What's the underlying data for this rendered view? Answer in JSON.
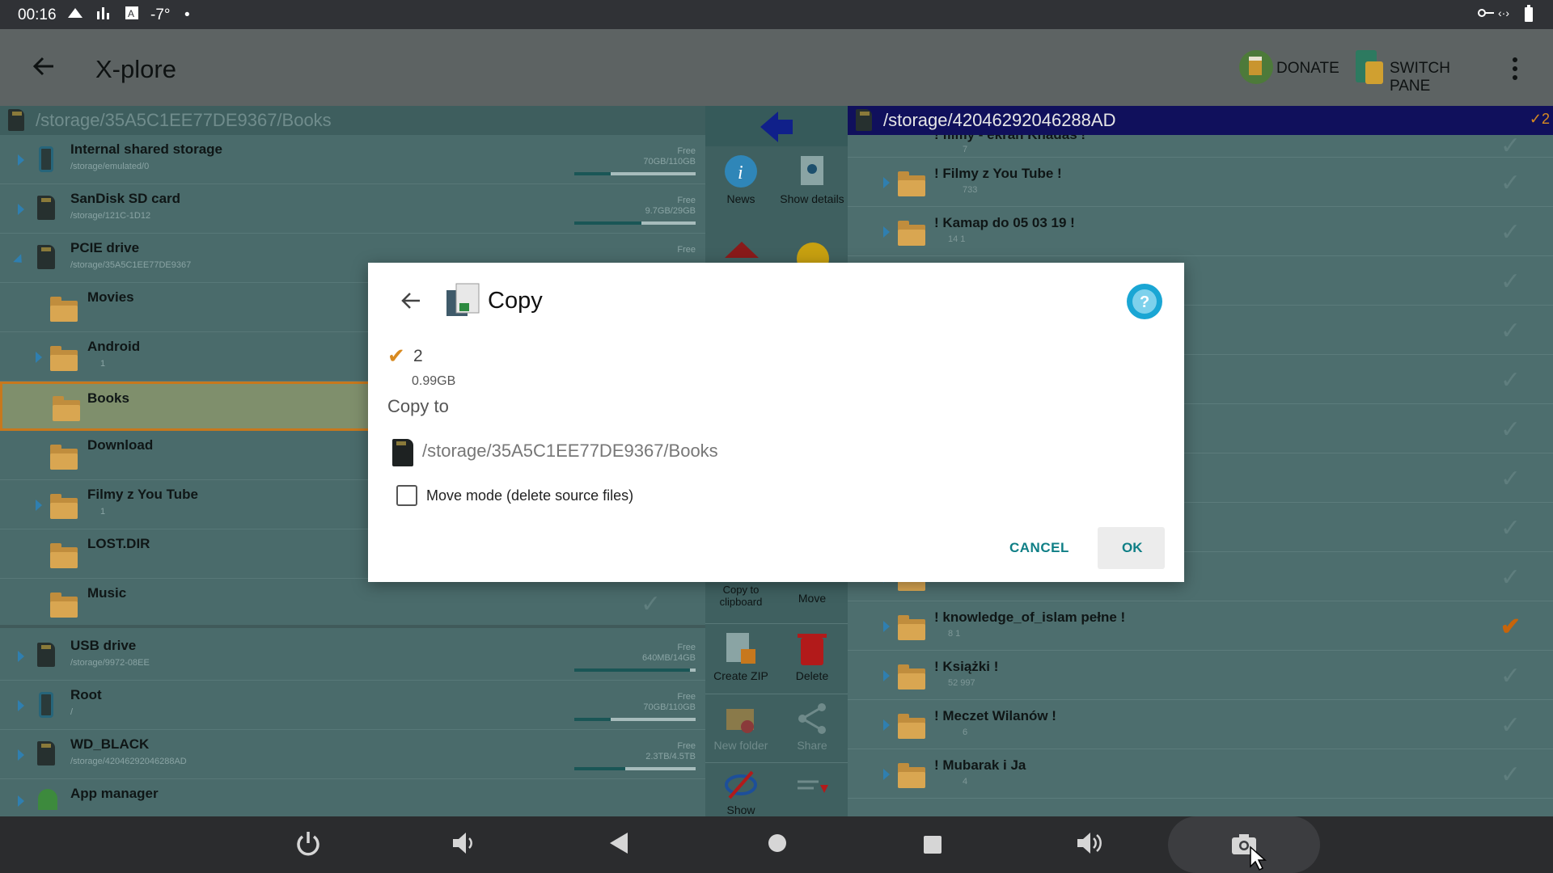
{
  "statusbar": {
    "time": "00:16",
    "temp": "-7°",
    "dot": "•"
  },
  "appbar": {
    "title": "X-plore",
    "donate": "DONATE",
    "switch_pane": "SWITCH PANE"
  },
  "left": {
    "path": "/storage/35A5C1EE77DE9367/Books",
    "devices": [
      {
        "name": "Internal shared storage",
        "path": "/storage/emulated/0",
        "free": "Free",
        "size": "70GB/110GB",
        "used": 0.3
      },
      {
        "name": "SanDisk SD card",
        "path": "/storage/121C-1D12",
        "free": "Free",
        "size": "9.7GB/29GB",
        "used": 0.55
      },
      {
        "name": "PCIE drive",
        "path": "/storage/35A5C1EE77DE9367",
        "free": "Free"
      }
    ],
    "folders": [
      {
        "name": "Movies",
        "meta": ""
      },
      {
        "name": "Android",
        "meta": "1"
      },
      {
        "name": "Books",
        "meta": ""
      },
      {
        "name": "Download",
        "meta": ""
      },
      {
        "name": "Filmy z You Tube",
        "meta": "1"
      },
      {
        "name": "LOST.DIR",
        "meta": ""
      },
      {
        "name": "Music",
        "meta": ""
      }
    ],
    "devices2": [
      {
        "name": "USB drive",
        "path": "/storage/9972-08EE",
        "free": "Free",
        "size": "640MB/14GB",
        "used": 0.95
      },
      {
        "name": "Root",
        "path": "/",
        "free": "Free",
        "size": "70GB/110GB",
        "used": 0.3
      },
      {
        "name": "WD_BLACK",
        "path": "/storage/42046292046288AD",
        "free": "Free",
        "size": "2.3TB/4.5TB",
        "used": 0.42
      },
      {
        "name": "App manager",
        "path": ""
      }
    ]
  },
  "mid": {
    "news": "News",
    "show_details": "Show details",
    "copy_clipboard": "Copy to clipboard",
    "move": "Move",
    "create_zip": "Create ZIP",
    "delete": "Delete",
    "new_folder": "New folder",
    "share": "Share",
    "show": "Show"
  },
  "right": {
    "path": "/storage/42046292046288AD",
    "sel_count": "2",
    "rows": [
      {
        "name": "! filmy - ekran Khadas !",
        "meta": "7"
      },
      {
        "name": "! Filmy z You Tube !",
        "meta": "733"
      },
      {
        "name": "! Kamap do 05 03 19 !",
        "meta": "14   1"
      },
      {
        "name": "! knowledge_of_islam pełne !",
        "meta": "8   1"
      },
      {
        "name": "! Książki !",
        "meta": "52   997"
      },
      {
        "name": "! Meczet Wilanów !",
        "meta": "6"
      },
      {
        "name": "! Mubarak i Ja",
        "meta": "4"
      }
    ]
  },
  "dialog": {
    "title": "Copy",
    "count": "2",
    "size": "0.99GB",
    "copy_to_label": "Copy to",
    "dest_path": "/storage/35A5C1EE77DE9367/Books",
    "move_mode": "Move mode (delete source files)",
    "cancel": "CANCEL",
    "ok": "OK",
    "help": "?"
  }
}
